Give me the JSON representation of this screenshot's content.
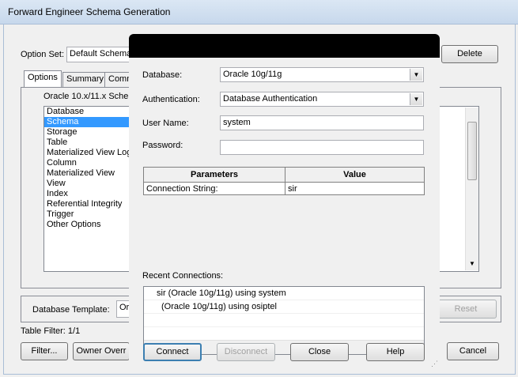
{
  "window": {
    "title": "Forward Engineer Schema Generation",
    "option_set_label": "Option Set:",
    "option_set_value": "Default Schema",
    "delete_button": "Delete",
    "tabs": [
      "Options",
      "Summary",
      "Comm"
    ],
    "group_title": "Oracle 10.x/11.x Sche",
    "categories": [
      "Database",
      "Schema",
      "Storage",
      "Table",
      "Materialized View Log",
      "Column",
      "Materialized View",
      "View",
      "Index",
      "Referential Integrity",
      "Trigger",
      "Other Options"
    ],
    "selected_category": "Schema",
    "db_template_label": "Database Template:",
    "db_template_value": "Or",
    "reset_button": "Reset",
    "table_filter": "Table Filter: 1/1",
    "filter_button": "Filter...",
    "owner_button": "Owner Overr",
    "cancel_button": "Cancel"
  },
  "dialog": {
    "database_label": "Database:",
    "database_value": "Oracle 10g/11g",
    "auth_label": "Authentication:",
    "auth_value": "Database Authentication",
    "username_label": "User Name:",
    "username_value": "system",
    "password_label": "Password:",
    "password_value": "",
    "params_header": "Parameters",
    "value_header": "Value",
    "params_rows": [
      {
        "name": "Connection String:",
        "value": "sir"
      }
    ],
    "recent_label": "Recent Connections:",
    "recent": [
      "sir (Oracle 10g/11g) using system",
      "(Oracle 10g/11g) using osiptel"
    ],
    "connect_button": "Connect",
    "disconnect_button": "Disconnect",
    "close_button": "Close",
    "help_button": "Help"
  }
}
